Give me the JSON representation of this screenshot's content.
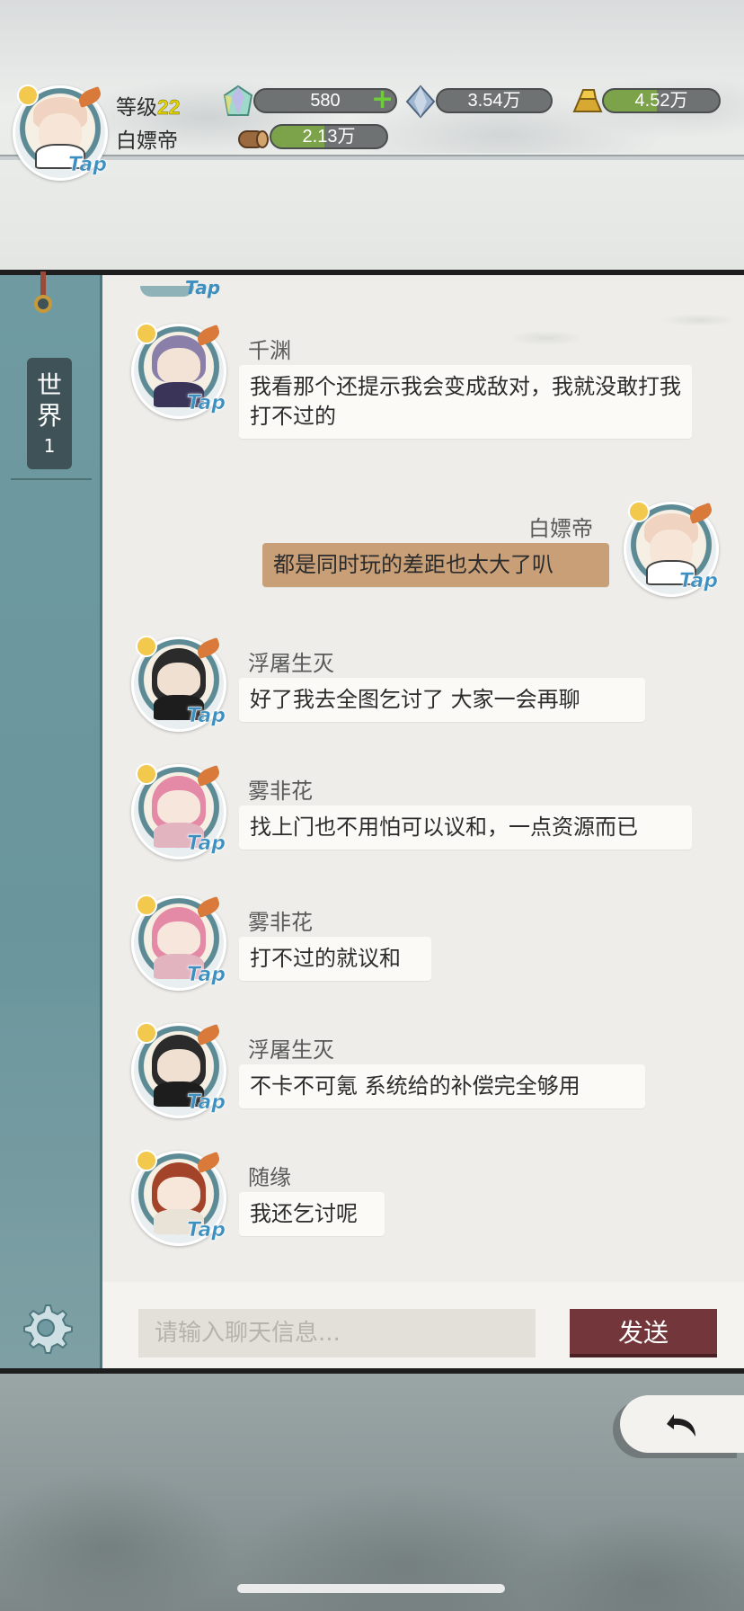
{
  "player": {
    "level_label": "等级",
    "level": "22",
    "name": "白嫖帝",
    "tap_label": "Tap"
  },
  "resources": {
    "gems": "580",
    "crystals": "3.54万",
    "gold": "4.52万",
    "wood": "2.13万"
  },
  "channel_tab": {
    "label": "世界",
    "number": "1"
  },
  "messages": [
    {
      "name": "千渊",
      "text": "我看那个还提示我会变成敌对，我就没敢打我打不过的",
      "self": false
    },
    {
      "name": "白嫖帝",
      "text": "都是同时玩的差距也太大了叭",
      "self": true
    },
    {
      "name": "浮屠生灭",
      "text": "好了我去全图乞讨了 大家一会再聊",
      "self": false
    },
    {
      "name": "雾非花",
      "text": "找上门也不用怕可以议和，一点资源而已",
      "self": false
    },
    {
      "name": "雾非花",
      "text": "打不过的就议和",
      "self": false
    },
    {
      "name": "浮屠生灭",
      "text": "不卡不可氪 系统给的补偿完全够用",
      "self": false
    },
    {
      "name": "随缘",
      "text": "我还乞讨呢",
      "self": false
    }
  ],
  "tap_label": "Tap",
  "input": {
    "placeholder": "请输入聊天信息..."
  },
  "send_label": "发送",
  "icons": {
    "settings": "gear-icon",
    "back": "back-arrow-icon",
    "gem": "gem-icon",
    "crystal": "crystal-icon",
    "gold": "gold-ingot-icon",
    "wood": "wood-log-icon",
    "add": "plus-icon"
  },
  "colors": {
    "self_bubble": "#c99f78",
    "send_button": "#73363a",
    "side_panel": "#6f9aa2",
    "level_number": "#e4d600"
  }
}
